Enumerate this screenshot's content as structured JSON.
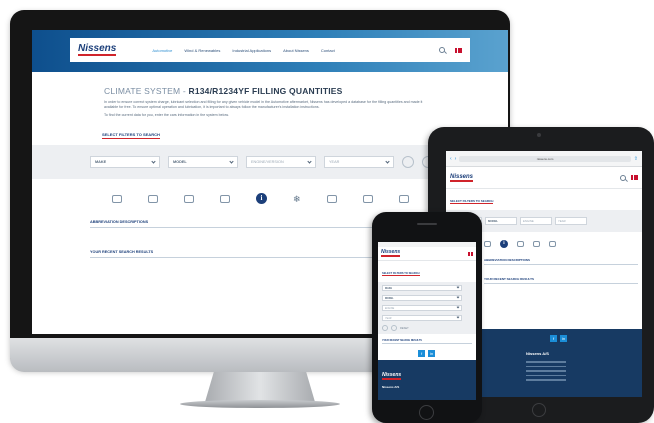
{
  "desktop": {
    "logo": "Nissens",
    "nav": [
      "Automotive",
      "Wind & Renewables",
      "Industrial Applications",
      "About Nissens",
      "Contact"
    ],
    "title_prefix": "CLIMATE SYSTEM - ",
    "title_bold": "R134/R1234YF FILLING QUANTITIES",
    "paragraph": "In order to ensure correct system charge, lubricant selection and filling for any given vehicle model in the Automotive aftermarket, Nissens has developed a database for the filling quantities and made it available for free. To ensure optimal operation and lubrication, it is important to always follow the manufacturer's installation instructions.",
    "paragraph2": "To find the current data for you, enter the cars information in the system below.",
    "filter_heading": "SELECT FILTERS TO SEARCH",
    "selects": [
      "MAKE",
      "MODEL",
      "ENGINE/VERSION",
      "YEAR"
    ],
    "section1": "ABBREVIATION DESCRIPTIONS",
    "section2": "YOUR RECENT SEARCH RESULTS",
    "info_glyph": "i"
  },
  "tablet": {
    "url": "nissens.com",
    "logo": "Nissens",
    "filter_heading": "SELECT FILTERS TO SEARCH",
    "selects": [
      "MAKE",
      "MODEL",
      "ENGINE",
      "YEAR"
    ],
    "section1": "ABBREVIATION DESCRIPTIONS",
    "section2": "YOUR RECENT SEARCH RESULTS",
    "footer_title": "Nissens A/S",
    "social": [
      "f",
      "in"
    ],
    "info_glyph": "i"
  },
  "phone": {
    "logo": "Nissens",
    "filter_heading": "SELECT FILTERS TO SEARCH",
    "selects": [
      "MAKE",
      "MODEL",
      "ENGINE",
      "YEAR"
    ],
    "reset": "RESET",
    "section": "YOUR RECENT SEARCH RESULTS",
    "footer_logo": "Nissens",
    "footer_title": "Nissens A/S",
    "social": [
      "f",
      "in"
    ]
  },
  "colors": {
    "brand_blue": "#1c3f7a",
    "accent_red": "#d0242b",
    "link_blue": "#2f8fd1",
    "footer_navy": "#173a63"
  }
}
